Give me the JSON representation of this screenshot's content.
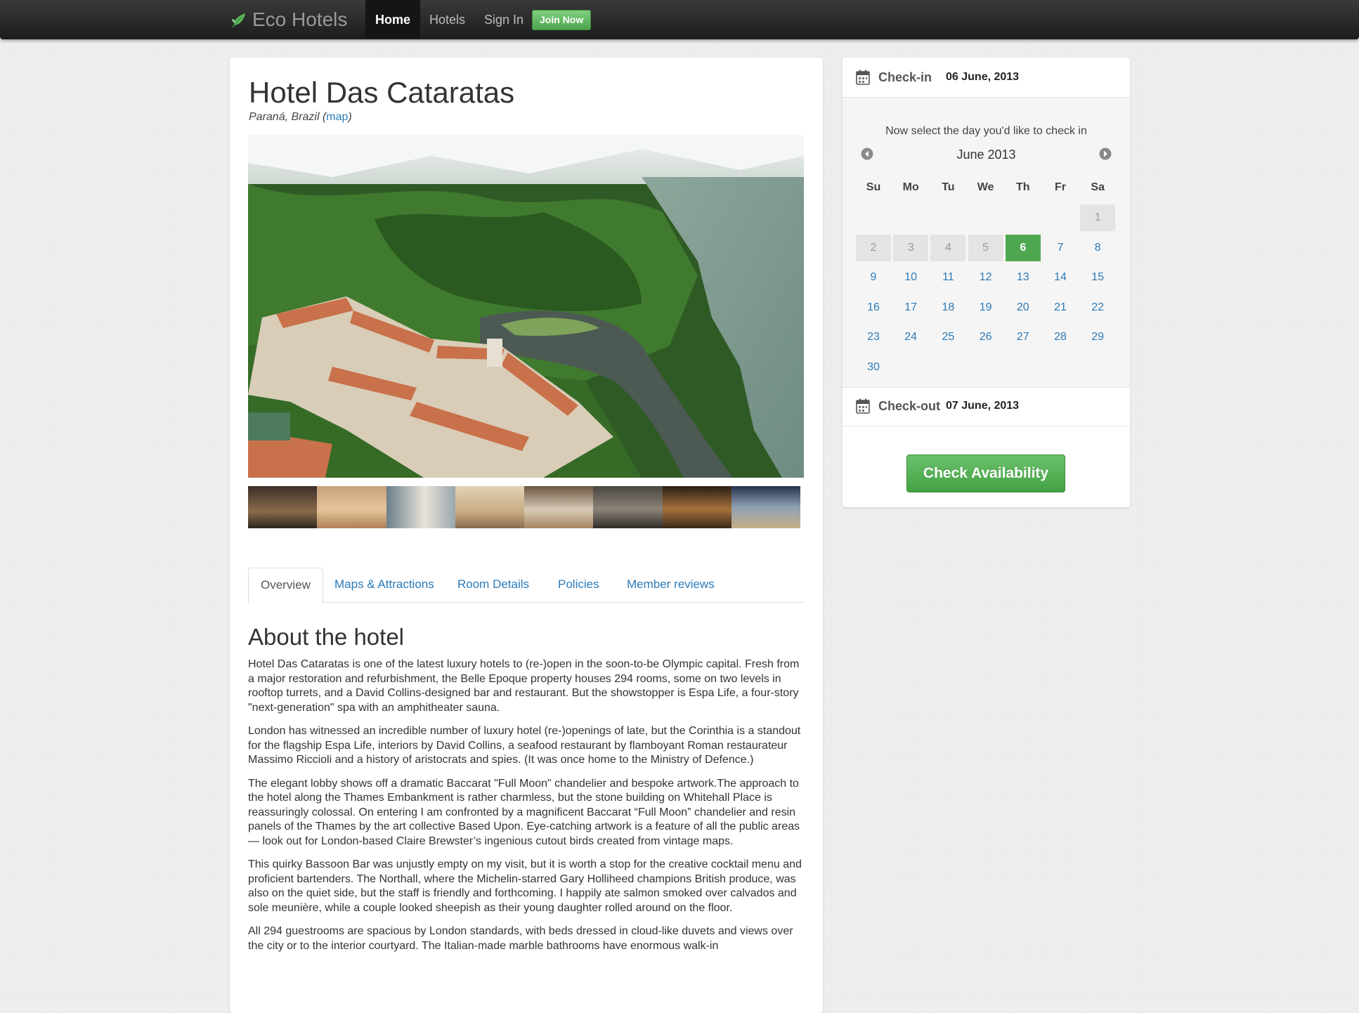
{
  "nav": {
    "brand": "Eco Hotels",
    "items": [
      {
        "label": "Home",
        "active": true
      },
      {
        "label": "Hotels"
      },
      {
        "label": "Sign In"
      }
    ],
    "join_label": "Join Now",
    "accent_color": "#4ea54e"
  },
  "hotel": {
    "name": "Hotel Das Cataratas",
    "location": "Paraná, Brazil",
    "map_link": "map",
    "thumbnail_count": 8
  },
  "tabs": [
    {
      "label": "Overview",
      "active": true
    },
    {
      "label": "Maps & Attractions"
    },
    {
      "label": "Room Details"
    },
    {
      "label": "Policies"
    },
    {
      "label": "Member reviews"
    }
  ],
  "about": {
    "title": "About the hotel",
    "paragraphs": [
      "Hotel Das Cataratas is one of the latest luxury hotels to (re-)open in the soon-to-be Olympic capital. Fresh from a major restoration and refurbishment, the Belle Epoque property houses 294 rooms, some on two levels in rooftop turrets, and a David Collins-designed bar and restaurant. But the showstopper is Espa Life, a four-story \"next-generation\" spa with an amphitheater sauna.",
      "London has witnessed an incredible number of luxury hotel (re-)openings of late, but the Corinthia is a standout for the flagship Espa Life, interiors by David Collins, a seafood restaurant by flamboyant Roman restaurateur Massimo Riccioli and a history of aristocrats and spies. (It was once home to the Ministry of Defence.)",
      "The elegant lobby shows off a dramatic Baccarat \"Full Moon\" chandelier and bespoke artwork.The approach to the hotel along the Thames Embankment is rather charmless, but the stone building on Whitehall Place is reassuringly colossal. On entering I am confronted by a magnificent Baccarat “Full Moon” chandelier and resin panels of the Thames by the art collective Based Upon. Eye-catching artwork is a feature of all the public areas — look out for London-based Claire Brewster’s ingenious cutout birds created from vintage maps.",
      "This quirky Bassoon Bar was unjustly empty on my visit, but it is worth a stop for the creative cocktail menu and proficient bartenders. The Northall, where the Michelin-starred Gary Holliheed champions British produce, was also on the quiet side, but the staff is friendly and forthcoming. I happily ate salmon smoked over calvados and sole meunière, while a couple looked sheepish as their young daughter rolled around on the floor.",
      "All 294 guestrooms are spacious by London standards, with beds dressed in cloud-like duvets and views over the city or to the interior courtyard. The Italian-made marble bathrooms have enormous walk-in"
    ]
  },
  "booking": {
    "checkin_label": "Check-in",
    "checkin_value": "06 June, 2013",
    "hint": "Now select the day you'd like to check in",
    "month": "June 2013",
    "weekdays": [
      "Su",
      "Mo",
      "Tu",
      "We",
      "Th",
      "Fr",
      "Sa"
    ],
    "first_weekday_index": 6,
    "days_in_month": 30,
    "disabled_days": [
      1,
      2,
      3,
      4,
      5
    ],
    "selected_day": 6,
    "checkout_label": "Check-out",
    "checkout_value": "07 June, 2013",
    "button_label": "Check Availability",
    "selected_color": "#4fa84f"
  }
}
